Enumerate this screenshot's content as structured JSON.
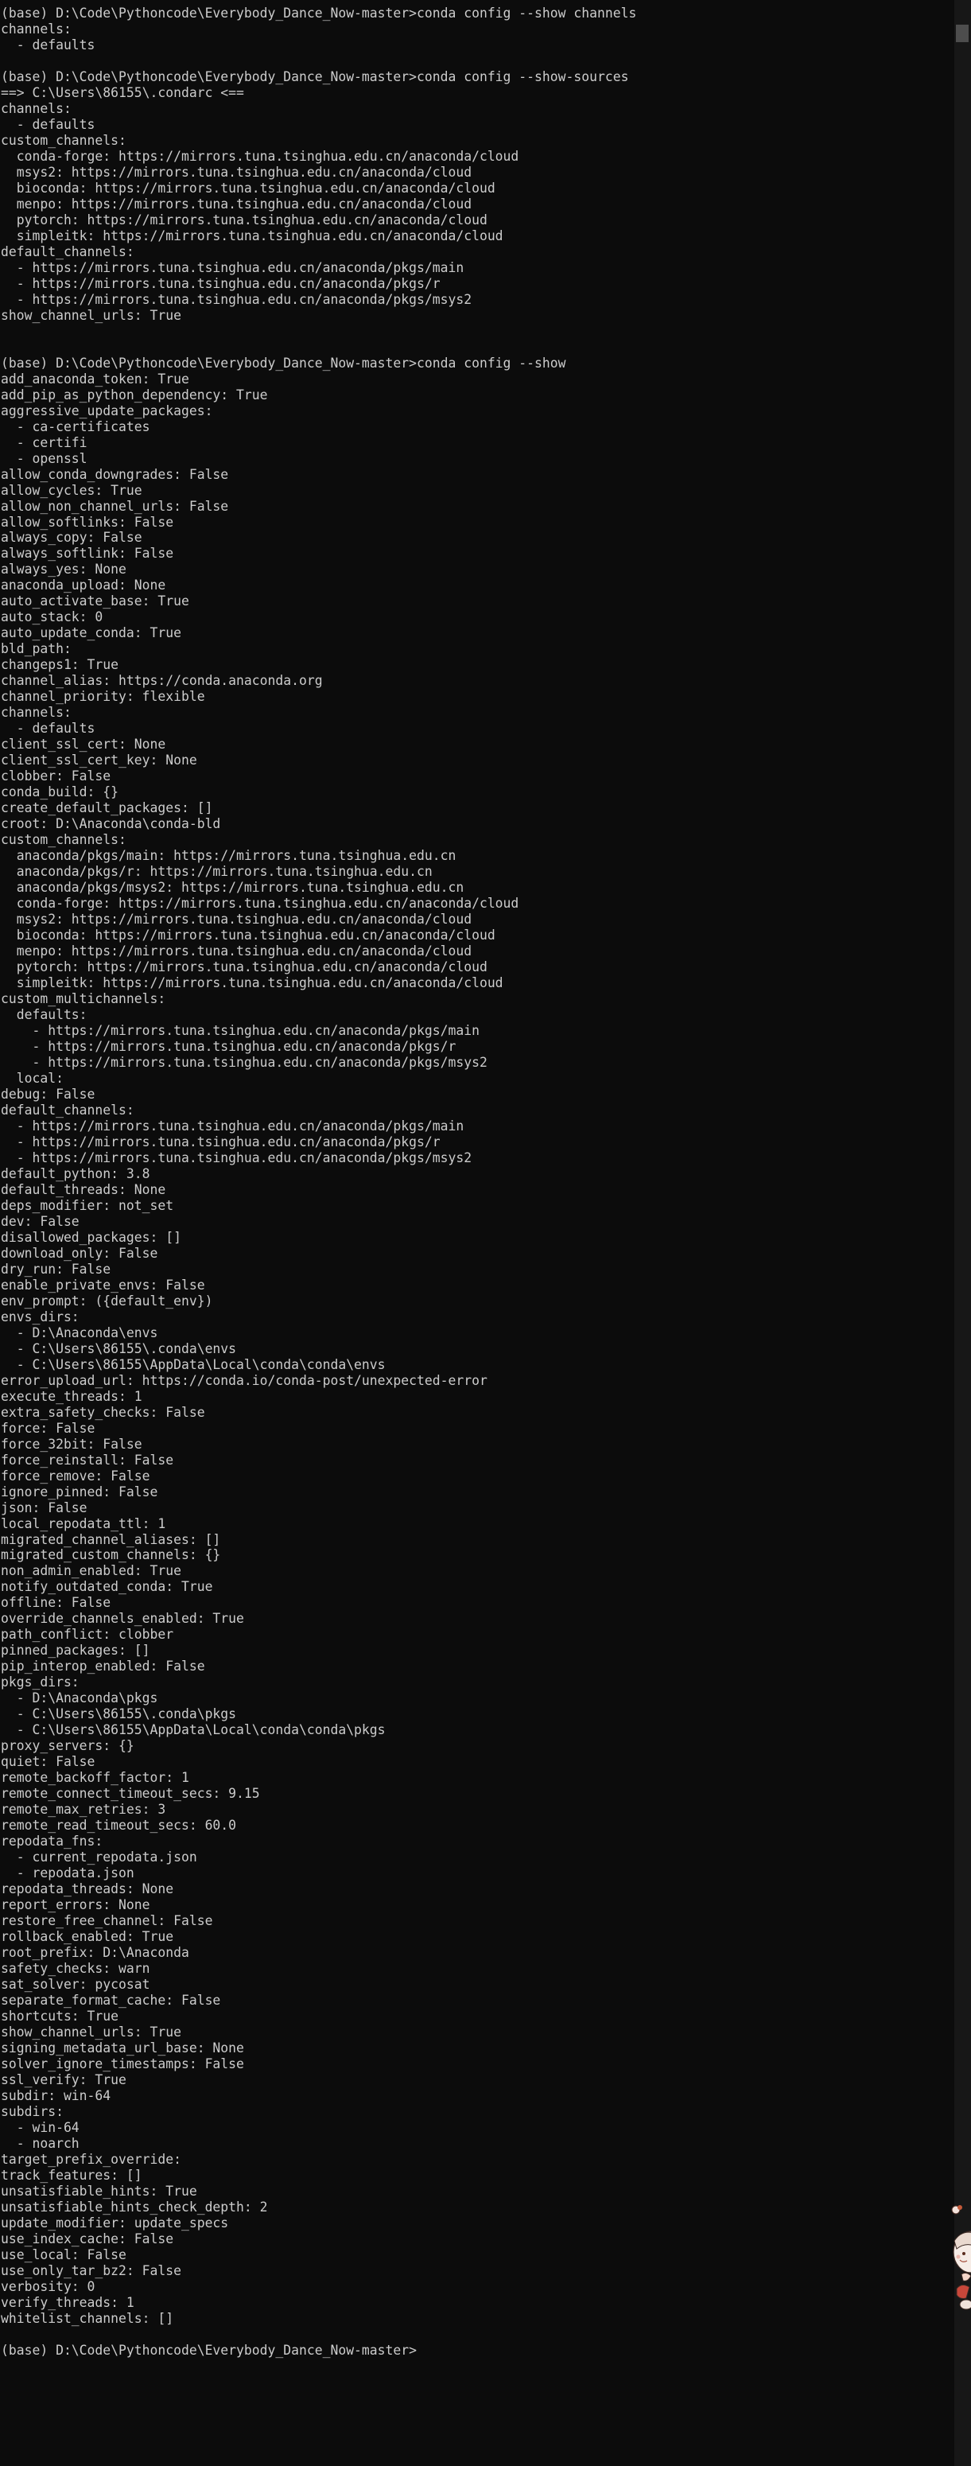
{
  "console": {
    "lines": [
      "(base) D:\\Code\\Pythoncode\\Everybody_Dance_Now-master>conda config --show channels",
      "channels:",
      "  - defaults",
      "",
      "(base) D:\\Code\\Pythoncode\\Everybody_Dance_Now-master>conda config --show-sources",
      "==> C:\\Users\\86155\\.condarc <==",
      "channels:",
      "  - defaults",
      "custom_channels:",
      "  conda-forge: https://mirrors.tuna.tsinghua.edu.cn/anaconda/cloud",
      "  msys2: https://mirrors.tuna.tsinghua.edu.cn/anaconda/cloud",
      "  bioconda: https://mirrors.tuna.tsinghua.edu.cn/anaconda/cloud",
      "  menpo: https://mirrors.tuna.tsinghua.edu.cn/anaconda/cloud",
      "  pytorch: https://mirrors.tuna.tsinghua.edu.cn/anaconda/cloud",
      "  simpleitk: https://mirrors.tuna.tsinghua.edu.cn/anaconda/cloud",
      "default_channels:",
      "  - https://mirrors.tuna.tsinghua.edu.cn/anaconda/pkgs/main",
      "  - https://mirrors.tuna.tsinghua.edu.cn/anaconda/pkgs/r",
      "  - https://mirrors.tuna.tsinghua.edu.cn/anaconda/pkgs/msys2",
      "show_channel_urls: True",
      "",
      "",
      "(base) D:\\Code\\Pythoncode\\Everybody_Dance_Now-master>conda config --show",
      "add_anaconda_token: True",
      "add_pip_as_python_dependency: True",
      "aggressive_update_packages:",
      "  - ca-certificates",
      "  - certifi",
      "  - openssl",
      "allow_conda_downgrades: False",
      "allow_cycles: True",
      "allow_non_channel_urls: False",
      "allow_softlinks: False",
      "always_copy: False",
      "always_softlink: False",
      "always_yes: None",
      "anaconda_upload: None",
      "auto_activate_base: True",
      "auto_stack: 0",
      "auto_update_conda: True",
      "bld_path:",
      "changeps1: True",
      "channel_alias: https://conda.anaconda.org",
      "channel_priority: flexible",
      "channels:",
      "  - defaults",
      "client_ssl_cert: None",
      "client_ssl_cert_key: None",
      "clobber: False",
      "conda_build: {}",
      "create_default_packages: []",
      "croot: D:\\Anaconda\\conda-bld",
      "custom_channels:",
      "  anaconda/pkgs/main: https://mirrors.tuna.tsinghua.edu.cn",
      "  anaconda/pkgs/r: https://mirrors.tuna.tsinghua.edu.cn",
      "  anaconda/pkgs/msys2: https://mirrors.tuna.tsinghua.edu.cn",
      "  conda-forge: https://mirrors.tuna.tsinghua.edu.cn/anaconda/cloud",
      "  msys2: https://mirrors.tuna.tsinghua.edu.cn/anaconda/cloud",
      "  bioconda: https://mirrors.tuna.tsinghua.edu.cn/anaconda/cloud",
      "  menpo: https://mirrors.tuna.tsinghua.edu.cn/anaconda/cloud",
      "  pytorch: https://mirrors.tuna.tsinghua.edu.cn/anaconda/cloud",
      "  simpleitk: https://mirrors.tuna.tsinghua.edu.cn/anaconda/cloud",
      "custom_multichannels:",
      "  defaults:",
      "    - https://mirrors.tuna.tsinghua.edu.cn/anaconda/pkgs/main",
      "    - https://mirrors.tuna.tsinghua.edu.cn/anaconda/pkgs/r",
      "    - https://mirrors.tuna.tsinghua.edu.cn/anaconda/pkgs/msys2",
      "  local:",
      "debug: False",
      "default_channels:",
      "  - https://mirrors.tuna.tsinghua.edu.cn/anaconda/pkgs/main",
      "  - https://mirrors.tuna.tsinghua.edu.cn/anaconda/pkgs/r",
      "  - https://mirrors.tuna.tsinghua.edu.cn/anaconda/pkgs/msys2",
      "default_python: 3.8",
      "default_threads: None",
      "deps_modifier: not_set",
      "dev: False",
      "disallowed_packages: []",
      "download_only: False",
      "dry_run: False",
      "enable_private_envs: False",
      "env_prompt: ({default_env})",
      "envs_dirs:",
      "  - D:\\Anaconda\\envs",
      "  - C:\\Users\\86155\\.conda\\envs",
      "  - C:\\Users\\86155\\AppData\\Local\\conda\\conda\\envs",
      "error_upload_url: https://conda.io/conda-post/unexpected-error",
      "execute_threads: 1",
      "extra_safety_checks: False",
      "force: False",
      "force_32bit: False",
      "force_reinstall: False",
      "force_remove: False",
      "ignore_pinned: False",
      "json: False",
      "local_repodata_ttl: 1",
      "migrated_channel_aliases: []",
      "migrated_custom_channels: {}",
      "non_admin_enabled: True",
      "notify_outdated_conda: True",
      "offline: False",
      "override_channels_enabled: True",
      "path_conflict: clobber",
      "pinned_packages: []",
      "pip_interop_enabled: False",
      "pkgs_dirs:",
      "  - D:\\Anaconda\\pkgs",
      "  - C:\\Users\\86155\\.conda\\pkgs",
      "  - C:\\Users\\86155\\AppData\\Local\\conda\\conda\\pkgs",
      "proxy_servers: {}",
      "quiet: False",
      "remote_backoff_factor: 1",
      "remote_connect_timeout_secs: 9.15",
      "remote_max_retries: 3",
      "remote_read_timeout_secs: 60.0",
      "repodata_fns:",
      "  - current_repodata.json",
      "  - repodata.json",
      "repodata_threads: None",
      "report_errors: None",
      "restore_free_channel: False",
      "rollback_enabled: True",
      "root_prefix: D:\\Anaconda",
      "safety_checks: warn",
      "sat_solver: pycosat",
      "separate_format_cache: False",
      "shortcuts: True",
      "show_channel_urls: True",
      "signing_metadata_url_base: None",
      "solver_ignore_timestamps: False",
      "ssl_verify: True",
      "subdir: win-64",
      "subdirs:",
      "  - win-64",
      "  - noarch",
      "target_prefix_override:",
      "track_features: []",
      "unsatisfiable_hints: True",
      "unsatisfiable_hints_check_depth: 2",
      "update_modifier: update_specs",
      "use_index_cache: False",
      "use_local: False",
      "use_only_tar_bz2: False",
      "verbosity: 0",
      "verify_threads: 1",
      "whitelist_channels: []",
      "",
      "(base) D:\\Code\\Pythoncode\\Everybody_Dance_Now-master>"
    ]
  },
  "colors": {
    "background": "#0c0c0c",
    "text": "#cccccc",
    "scrollbar_track": "#171717",
    "scrollbar_thumb": "#4d4d4d"
  },
  "icons": {
    "mascot": "anime-girl-mascot-icon"
  }
}
